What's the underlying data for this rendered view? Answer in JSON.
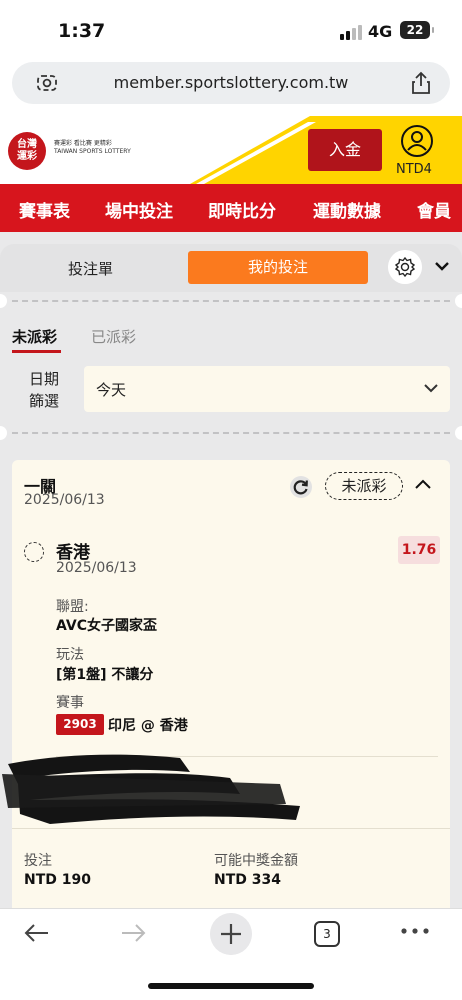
{
  "status_bar": {
    "time": "1:37",
    "network": "4G",
    "battery": "22"
  },
  "browser": {
    "url": "member.sportslottery.com.tw",
    "open_tabs": "3"
  },
  "header": {
    "logo_text": "台灣\n運彩",
    "logo_tagline": "賽運彩 看比賽 更精彩\nTAIWAN SPORTS LOTTERY",
    "deposit_label": "入金",
    "balance_label": "NTD4",
    "colors": {
      "brand_red": "#d7151d",
      "accent_yellow": "#ffd400"
    }
  },
  "nav": {
    "items": [
      "賽事表",
      "場中投注",
      "即時比分",
      "運動數據",
      "會員"
    ]
  },
  "bet_tabs": {
    "bet_slip": "投注單",
    "my_bets": "我的投注",
    "accent": "#fb7a1e"
  },
  "status_tabs": {
    "unsettled": "未派彩",
    "settled": "已派彩"
  },
  "date_filter": {
    "label": "日期\n篩選",
    "value": "今天"
  },
  "bet": {
    "type": "一關",
    "date": "2025/06/13",
    "status": "未派彩",
    "selection": {
      "name": "香港",
      "date": "2025/06/13",
      "odds": "1.76",
      "league_label": "聯盟:",
      "league": "AVC女子國家盃",
      "market_label": "玩法",
      "market": "[第1盤] 不讓分",
      "event_label": "賽事",
      "event_code": "2903",
      "event_teams": "印尼 @ 香港"
    },
    "stake_label": "投注",
    "stake": "NTD 190",
    "payout_label": "可能中獎金額",
    "payout": "NTD 334"
  },
  "icons": {
    "lens": "page-settings-icon",
    "share": "share-icon",
    "user": "user-icon",
    "gear": "gear-icon",
    "refresh": "refresh-icon"
  }
}
